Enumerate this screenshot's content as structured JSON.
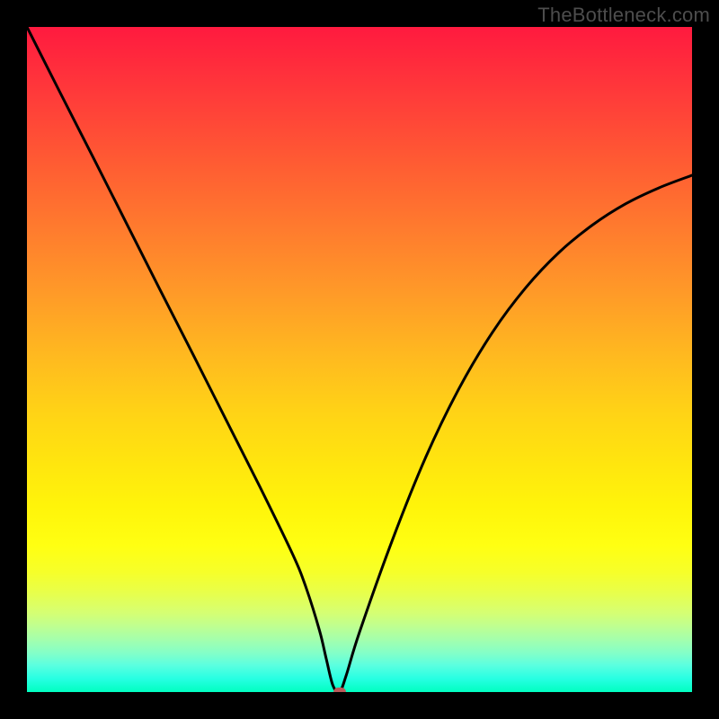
{
  "watermark": "TheBottleneck.com",
  "colors": {
    "frame_bg": "#000000",
    "curve_stroke": "#000000",
    "marker_fill": "#bb5a5a"
  },
  "chart_data": {
    "type": "line",
    "title": "",
    "xlabel": "",
    "ylabel": "",
    "xlim": [
      0,
      100
    ],
    "ylim": [
      0,
      100
    ],
    "grid": false,
    "legend": false,
    "x": [
      0,
      5,
      10,
      15,
      20,
      25,
      30,
      35,
      40,
      42,
      44,
      45,
      46,
      47,
      48,
      50,
      55,
      60,
      65,
      70,
      75,
      80,
      85,
      90,
      95,
      100
    ],
    "values": [
      100,
      90.1,
      80.3,
      70.4,
      60.5,
      50.7,
      40.8,
      30.9,
      20.6,
      15.6,
      9.2,
      5.0,
      1.0,
      0.0,
      2.5,
      9.0,
      23.0,
      35.4,
      45.7,
      54.1,
      60.8,
      66.1,
      70.2,
      73.4,
      75.8,
      77.7
    ],
    "minimum_marker": {
      "x": 47,
      "y": 0
    },
    "annotations": []
  }
}
